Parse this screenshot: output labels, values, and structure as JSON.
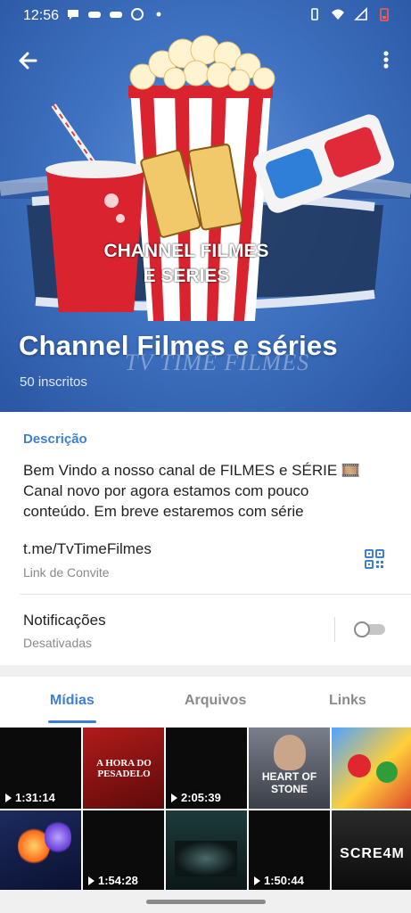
{
  "status_bar": {
    "time": "12:56"
  },
  "header": {
    "banner_line1": "CHANNEL FILMES",
    "banner_line2": "E SERIES",
    "watermark": "TV TIME FILMES",
    "title": "Channel Filmes e séries",
    "subscribers": "50 inscritos"
  },
  "info": {
    "description_title": "Descrição",
    "description_line1": "Bem Vindo a nosso canal de FILMES e SÉRIE 🎞️",
    "description_line2": "Canal novo por agora estamos com pouco",
    "description_line3": "conteúdo. Em breve estaremos com série",
    "link": "t.me/TvTimeFilmes",
    "link_label": "Link de Convite",
    "notifications_title": "Notificações",
    "notifications_status": "Desativadas",
    "notifications_enabled": false
  },
  "tabs": [
    {
      "label": "Mídias",
      "active": true
    },
    {
      "label": "Arquivos",
      "active": false
    },
    {
      "label": "Links",
      "active": false
    }
  ],
  "media": [
    {
      "duration": "1:31:14"
    },
    {
      "caption": "A HORA DO PESADELO"
    },
    {
      "duration": "2:05:39"
    },
    {
      "caption": "HEART OF STONE"
    },
    {
      "caption": ""
    },
    {
      "caption": ""
    },
    {
      "duration": "1:54:28"
    },
    {
      "caption": ""
    },
    {
      "duration": "1:50:44"
    },
    {
      "caption": "SCRE4M"
    }
  ],
  "colors": {
    "accent": "#3e7fd6",
    "hero_bg": "#3f73c2"
  }
}
